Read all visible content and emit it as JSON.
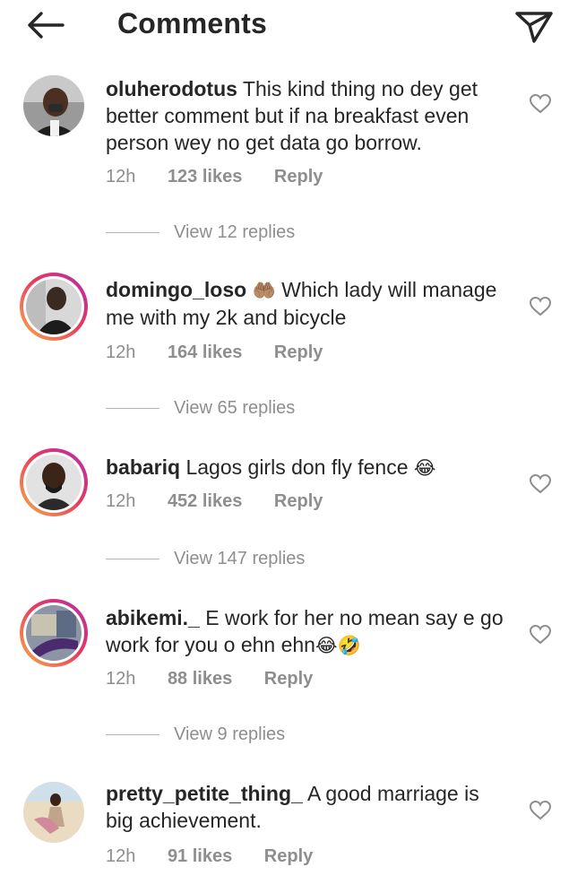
{
  "header": {
    "title": "Comments"
  },
  "comments": [
    {
      "username": "oluherodotus",
      "text": "This kind thing no dey get better comment but if na breakfast even person wey no get data go borrow.",
      "time": "12h",
      "likes": "123 likes",
      "reply": "Reply",
      "view_replies": "View 12 replies"
    },
    {
      "username": "domingo_loso",
      "emoji": "🤲🏽",
      "text": "Which lady will manage me with my 2k and bicycle",
      "time": "12h",
      "likes": "164 likes",
      "reply": "Reply",
      "view_replies": "View 65 replies"
    },
    {
      "username": "babariq",
      "text": "Lagos girls don fly fence",
      "emoji_end": "😂",
      "time": "12h",
      "likes": "452 likes",
      "reply": "Reply",
      "view_replies": "View 147 replies"
    },
    {
      "username": "abikemi._",
      "text": "E work for her no mean say e go work for you o ehn ehn",
      "emoji_end": "😂🤣",
      "time": "12h",
      "likes": "88 likes",
      "reply": "Reply",
      "view_replies": "View 9 replies"
    },
    {
      "username": "pretty_petite_thing_",
      "text": "A good marriage is big achievement.",
      "time": "12h",
      "likes": "91 likes",
      "reply": "Reply"
    }
  ]
}
